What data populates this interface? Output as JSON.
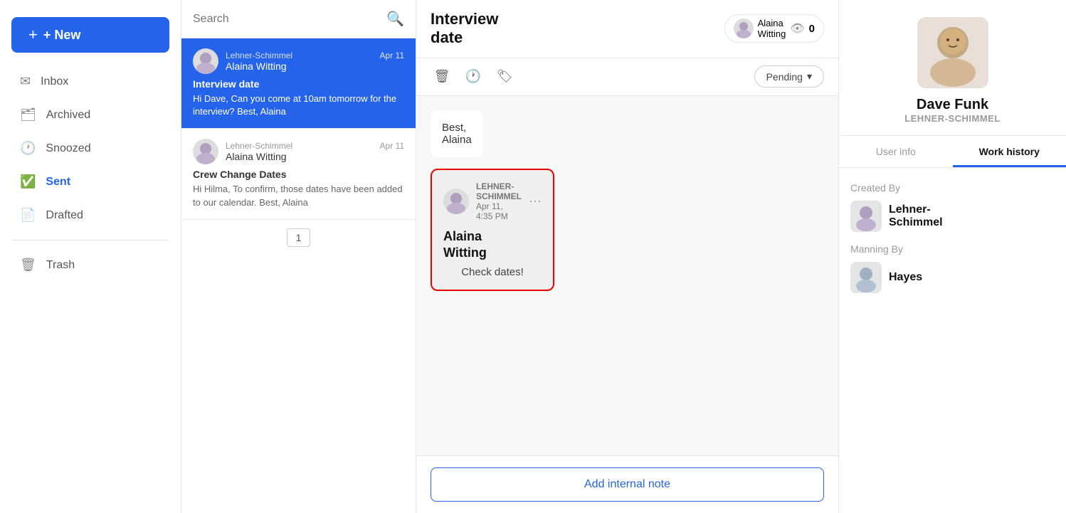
{
  "sidebar": {
    "new_button": "+ New",
    "nav_items": [
      {
        "id": "inbox",
        "label": "Inbox",
        "icon": "✉"
      },
      {
        "id": "archived",
        "label": "Archived",
        "icon": "🗂"
      },
      {
        "id": "snoozed",
        "label": "Snoozed",
        "icon": "🕐"
      },
      {
        "id": "sent",
        "label": "Sent",
        "icon": "✅"
      },
      {
        "id": "drafted",
        "label": "Drafted",
        "icon": "📄"
      },
      {
        "id": "trash",
        "label": "Trash",
        "icon": "🗑"
      }
    ]
  },
  "search": {
    "placeholder": "Search"
  },
  "messages": [
    {
      "id": "1",
      "company": "Lehner-Schimmel",
      "sender": "Alaina Witting",
      "date": "Apr 11",
      "subject": "Interview date",
      "preview": "Hi Dave, Can you come at 10am tomorrow for the interview? Best, Alaina",
      "selected": true
    },
    {
      "id": "2",
      "company": "Lehner-Schimmel",
      "sender": "Alaina Witting",
      "date": "Apr 11",
      "subject": "Crew Change Dates",
      "preview": "Hi Hilma, To confirm, those dates have been added to our calendar. Best, Alaina",
      "selected": false
    }
  ],
  "pagination": {
    "current": "1"
  },
  "conversation": {
    "title": "Interview\ndate",
    "watcher_name": "Alaina\nWitting",
    "watcher_count": "0",
    "status": "Pending",
    "message_text": "Best,\nAlaina",
    "card": {
      "company": "LEHNER-\nSCHIMMEL",
      "date": "Apr 11,",
      "time": "4:35 PM",
      "name": "Alaina\nWitting",
      "body": "Check dates!",
      "options": "···"
    }
  },
  "compose": {
    "add_note_label": "Add internal note"
  },
  "right_panel": {
    "profile": {
      "name": "Dave Funk",
      "company": "LEHNER-SCHIMMEL"
    },
    "tabs": [
      {
        "id": "user-info",
        "label": "User info"
      },
      {
        "id": "work-history",
        "label": "Work history"
      }
    ],
    "active_tab": "work-history",
    "created_by_label": "Created By",
    "created_by_name": "Lehner-\nSchimmel",
    "manning_by_label": "Manning By",
    "manning_by_name": "Hayes"
  },
  "icons": {
    "search": "🔍",
    "trash": "🗑",
    "clock": "🕐",
    "tag": "🏷",
    "chevron": "▾",
    "eye": "👁",
    "plus": "+"
  }
}
